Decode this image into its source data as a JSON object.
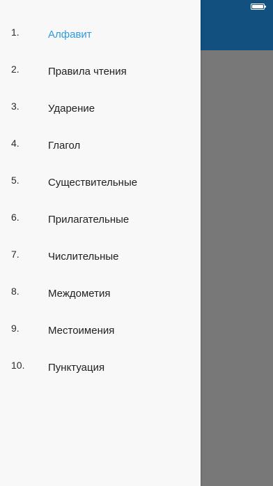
{
  "status_bar": {
    "battery_icon": "battery-icon"
  },
  "background": {
    "header_color": "#12507f",
    "overlay_color": "#787878"
  },
  "drawer": {
    "accent_color": "#2d9be0",
    "items": [
      {
        "number": "1.",
        "label": "Алфавит",
        "active": true
      },
      {
        "number": "2.",
        "label": "Правила чтения",
        "active": false
      },
      {
        "number": "3.",
        "label": "Ударение",
        "active": false
      },
      {
        "number": "4.",
        "label": "Глагол",
        "active": false
      },
      {
        "number": "5.",
        "label": "Существительные",
        "active": false
      },
      {
        "number": "6.",
        "label": "Прилагательные",
        "active": false
      },
      {
        "number": "7.",
        "label": "Числительные",
        "active": false
      },
      {
        "number": "8.",
        "label": "Междометия",
        "active": false
      },
      {
        "number": "9.",
        "label": "Местоимения",
        "active": false
      },
      {
        "number": "10.",
        "label": "Пунктуация",
        "active": false
      }
    ]
  }
}
